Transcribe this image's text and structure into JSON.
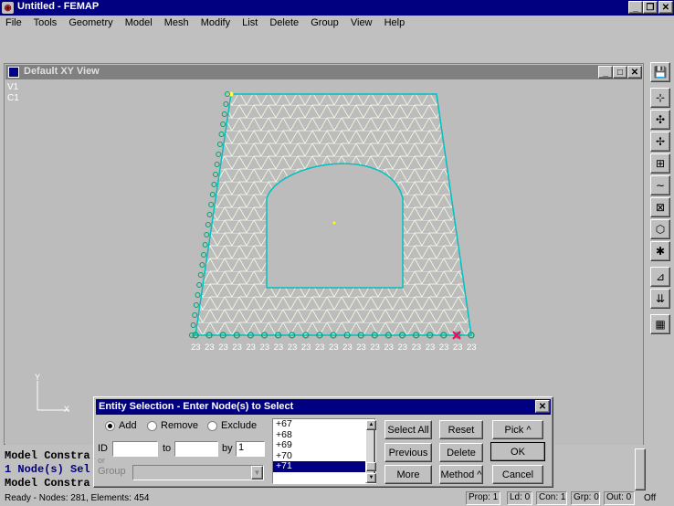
{
  "window": {
    "title": "Untitled - FEMAP"
  },
  "menu": [
    "File",
    "Tools",
    "Geometry",
    "Model",
    "Mesh",
    "Modify",
    "List",
    "Delete",
    "Group",
    "View",
    "Help"
  ],
  "view": {
    "title": "Default XY View",
    "labels": [
      "V1",
      "C1"
    ],
    "node_labels": [
      "23",
      "23",
      "23",
      "23",
      "23",
      "23",
      "23",
      "23",
      "23",
      "23",
      "23",
      "23",
      "23",
      "23",
      "23",
      "23",
      "23",
      "23",
      "23",
      "23",
      "23"
    ],
    "axis_x": "X",
    "axis_y": "Y"
  },
  "messages": [
    "Model Constra",
    "1 Node(s) Sel",
    "Model Constra"
  ],
  "status": {
    "left": "Ready - Nodes: 281,  Elements: 454",
    "prop": "Prop: 1",
    "ld": "Ld: 0",
    "con": "Con: 1",
    "grp": "Grp: 0",
    "out": "Out: 0",
    "off": "Off"
  },
  "dialog": {
    "title": "Entity Selection - Enter Node(s) to Select",
    "radio_add": "Add",
    "radio_remove": "Remove",
    "radio_exclude": "Exclude",
    "id_label": "ID",
    "to_label": "to",
    "by_label": "by",
    "by_value": "1",
    "or_label": "or",
    "group_label": "Group",
    "list_items": [
      "+67",
      "+68",
      "+69",
      "+70",
      "+71"
    ],
    "selected_index": 4,
    "buttons": {
      "select_all": "Select All",
      "reset": "Reset",
      "pick": "Pick ^",
      "previous": "Previous",
      "delete": "Delete",
      "ok": "OK",
      "more": "More",
      "method": "Method ^",
      "cancel": "Cancel"
    }
  },
  "colors": {
    "title_bar": "#000080",
    "mesh_line": "#ffffff",
    "mesh_edge": "#00c0c0",
    "node_dot": "#c8e060",
    "constraint": "#00a070"
  }
}
